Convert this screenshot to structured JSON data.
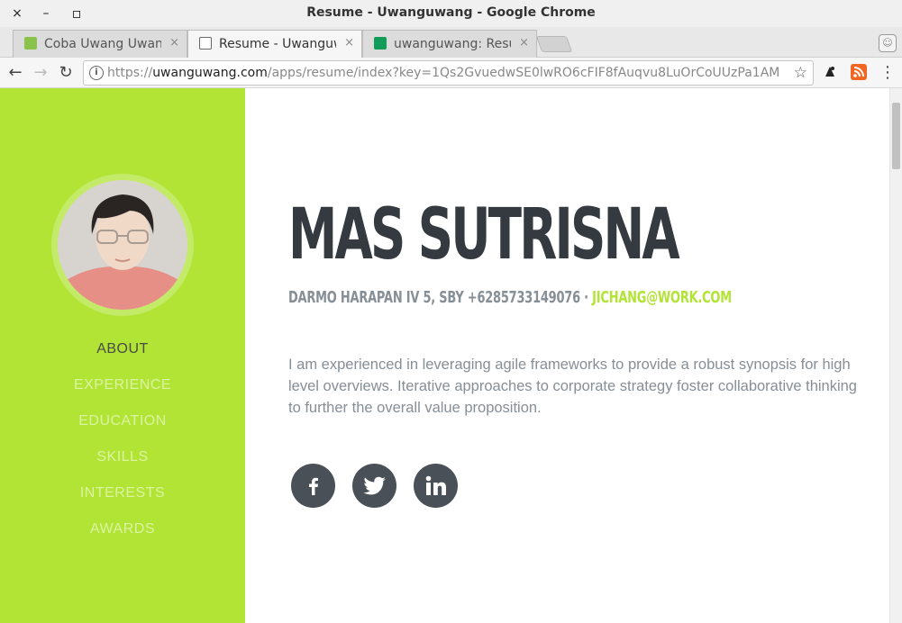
{
  "window": {
    "title": "Resume - Uwanguwang - Google Chrome",
    "close_glyph": "×",
    "minimize_glyph": "–",
    "maximize_glyph": "▫"
  },
  "tabs": [
    {
      "label": "Coba Uwang Uwang",
      "icon": "android-icon",
      "color": "#8bc34a",
      "active": false
    },
    {
      "label": "Resume - Uwanguwang",
      "icon": "page-icon",
      "color": "#777777",
      "active": true
    },
    {
      "label": "uwanguwang: Resume",
      "icon": "sheets-icon",
      "color": "#0f9d58",
      "active": false
    }
  ],
  "tab_close_glyph": "×",
  "toolbar": {
    "back_glyph": "←",
    "forward_glyph": "→",
    "reload_glyph": "↻",
    "url_prefix": "https://",
    "url_host": "uwanguwang.com",
    "url_path": "/apps/resume/index?key=1Qs2GvuedwSE0lwRO6cFIF8fAuqvu8LuOrCoUUzPa1AM",
    "info_glyph": "i",
    "star_glyph": "☆",
    "menu_glyph": "⋮"
  },
  "sidebar": {
    "accent": "#b1e434",
    "nav": [
      {
        "label": "About",
        "active": true
      },
      {
        "label": "Experience",
        "active": false
      },
      {
        "label": "Education",
        "active": false
      },
      {
        "label": "Skills",
        "active": false
      },
      {
        "label": "Interests",
        "active": false
      },
      {
        "label": "Awards",
        "active": false
      }
    ]
  },
  "about": {
    "name": "MAS SUTRISNA",
    "address": "DARMO HARAPAN IV 5, SBY +6285733149076 ·",
    "email": "JICHANG@WORK.COM",
    "lead": "I am experienced in leveraging agile frameworks to provide a robust synopsis for high level overviews. Iterative approaches to corporate strategy foster collaborative thinking to further the overall value proposition.",
    "social": [
      "facebook-icon",
      "twitter-icon",
      "linkedin-icon"
    ]
  }
}
